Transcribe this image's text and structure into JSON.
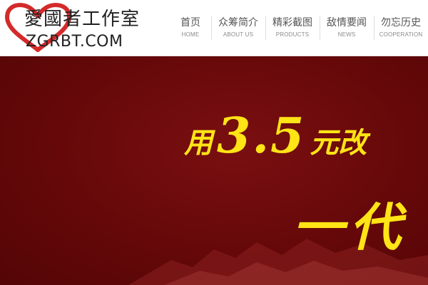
{
  "brand": {
    "name_cn": "愛國者工作室",
    "domain": "ZGRBT.COM",
    "heart_color": "#d42a2a"
  },
  "nav": {
    "items": [
      {
        "label_cn": "首页",
        "label_en": "HOME"
      },
      {
        "label_cn": "众筹简介",
        "label_en": "ABOUT US"
      },
      {
        "label_cn": "精彩截图",
        "label_en": "PRODUCTS"
      },
      {
        "label_cn": "敌情要闻",
        "label_en": "NEWS"
      },
      {
        "label_cn": "勿忘历史",
        "label_en": "COOPERATION"
      }
    ]
  },
  "banner": {
    "line1_pre": "用",
    "line1_number": "3.5",
    "line1_post": "元改",
    "line2": "一代",
    "text_color": "#ffe416",
    "background_color": "#650809"
  }
}
